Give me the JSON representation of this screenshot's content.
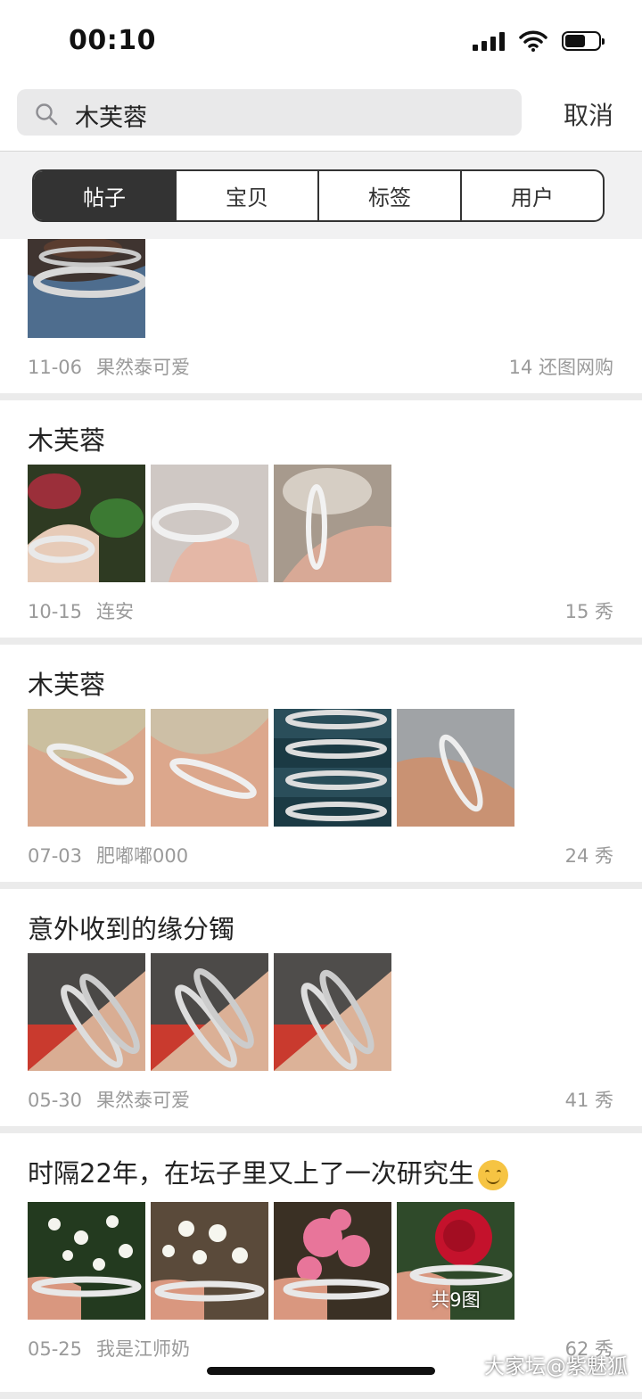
{
  "status_bar": {
    "time": "00:10",
    "battery_level": 0.6
  },
  "search": {
    "query": "木芙蓉",
    "cancel_label": "取消"
  },
  "tabs": [
    {
      "label": "帖子",
      "active": true
    },
    {
      "label": "宝贝",
      "active": false
    },
    {
      "label": "标签",
      "active": false
    },
    {
      "label": "用户",
      "active": false
    }
  ],
  "posts": [
    {
      "title": "",
      "images": [
        "bracelets on wrist with beads"
      ],
      "date": "11-06",
      "author": "果然泰可爱",
      "stats": "14 还图网购"
    },
    {
      "title": "木芙蓉",
      "images": [
        "bracelet among red-green leaves",
        "bracelet held in fingers",
        "bracelet against pillow"
      ],
      "date": "10-15",
      "author": "连安",
      "stats": "15 秀"
    },
    {
      "title": "木芙蓉",
      "images": [
        "bracelet on wrist",
        "bracelet on wrist",
        "bracelet collage",
        "bracelet on forearm"
      ],
      "date": "07-03",
      "author": "肥嘟嘟000",
      "stats": "24 秀"
    },
    {
      "title": "意外收到的缘分镯",
      "images": [
        "two bangles on arm",
        "two bangles on arm",
        "two bangles on arm"
      ],
      "date": "05-30",
      "author": "果然泰可爱",
      "stats": "41 秀"
    },
    {
      "title": "时隔22年，在坛子里又上了一次研究生",
      "emoji": "smiling-face",
      "images": [
        "bangle with white flowers",
        "bangle with white flowers",
        "bangle with pink roses",
        "bangle with red rose"
      ],
      "more_label": "共9图",
      "date": "05-25",
      "author": "我是江师奶",
      "stats": "62 秀"
    }
  ],
  "watermark": "大家坛@紫魅狐"
}
